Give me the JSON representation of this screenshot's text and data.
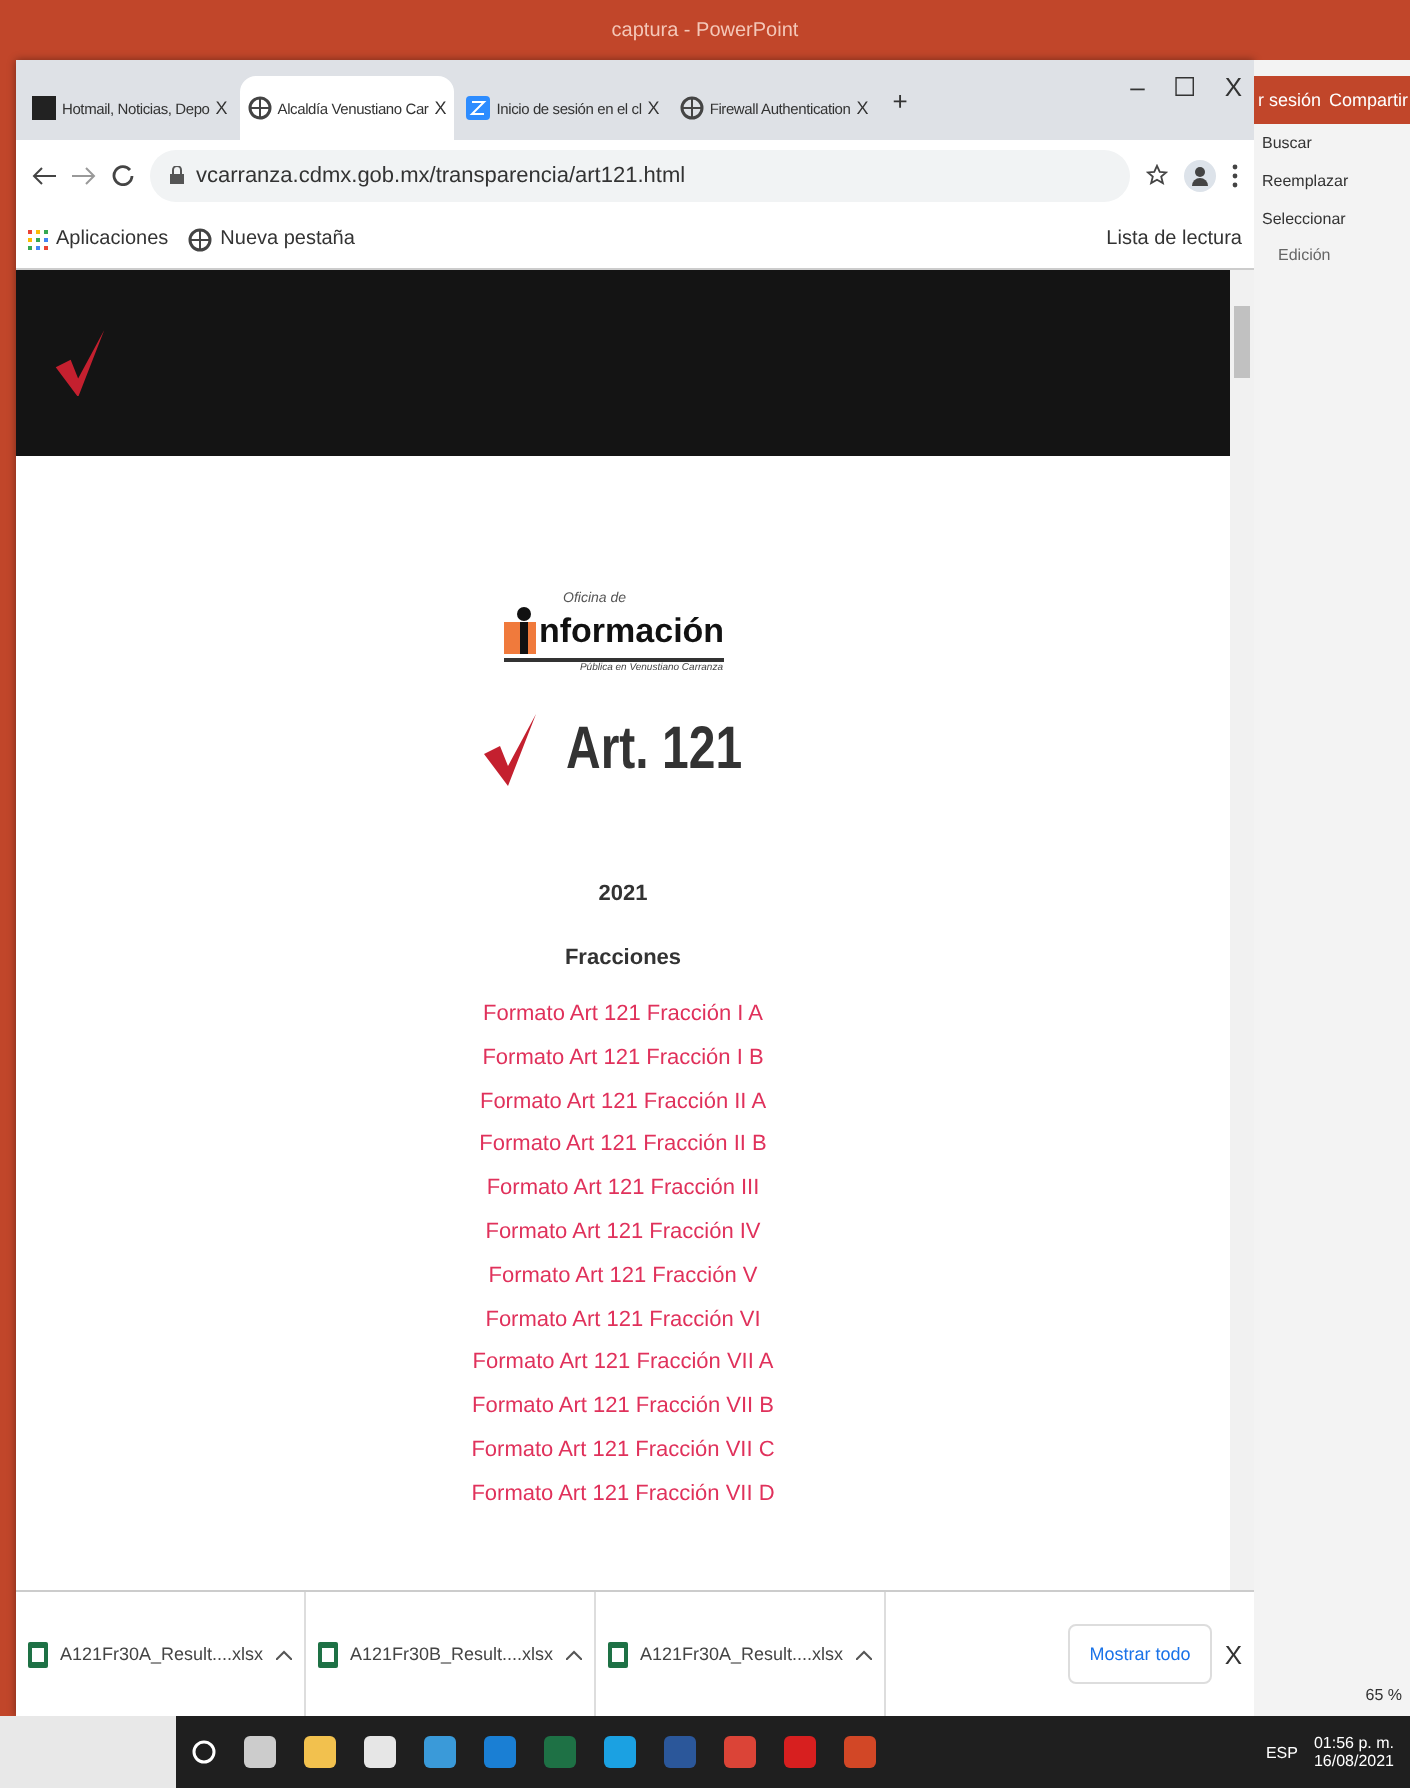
{
  "app_title": "captura - PowerPoint",
  "ribbon": {
    "account": [
      "r sesión",
      "Compartir"
    ],
    "items": [
      "Buscar",
      "Reemplazar",
      "Seleccionar"
    ],
    "group": "Edición",
    "zoom": "65 %"
  },
  "tabs": [
    {
      "label": "Hotmail, Noticias, Depo",
      "close": "X",
      "selected": false,
      "kind": "dark"
    },
    {
      "label": "Alcaldía Venustiano Car",
      "close": "X",
      "selected": true,
      "kind": "globe"
    },
    {
      "label": "Inicio de sesión en el cl",
      "close": "X",
      "selected": false,
      "kind": "z"
    },
    {
      "label": "Firewall Authentication",
      "close": "X",
      "selected": false,
      "kind": "globe"
    }
  ],
  "new_tab": "+",
  "window_controls": [
    "–",
    "☐",
    "X"
  ],
  "address": "vcarranza.cdmx.gob.mx/transparencia/art121.html",
  "bookmarks": [
    {
      "label": "Aplicaciones",
      "kind": "apps"
    },
    {
      "label": "Nueva pestaña",
      "kind": "globe"
    }
  ],
  "reading_list": "Lista de lectura",
  "page": {
    "logo_top": "Oficina de",
    "logo_main": "nformación",
    "logo_sub": "Pública en Venustiano Carranza",
    "heading": "Art. 121",
    "year": "2021",
    "section": "Fracciones",
    "links": [
      "Formato Art 121 Fracción I A",
      "Formato Art 121 Fracción I B",
      "Formato Art 121 Fracción II A",
      "Formato Art 121 Fracción II B",
      "Formato Art 121 Fracción III",
      "Formato Art 121 Fracción IV",
      "Formato Art 121 Fracción V",
      "Formato Art 121 Fracción VI",
      "Formato Art 121 Fracción VII A",
      "Formato Art 121 Fracción VII B",
      "Formato Art 121 Fracción VII C",
      "Formato Art 121 Fracción VII D"
    ]
  },
  "downloads": [
    "A121Fr30A_Result....xlsx",
    "A121Fr30B_Result....xlsx",
    "A121Fr30A_Result....xlsx"
  ],
  "show_all": "Mostrar todo",
  "downloads_close": "X",
  "taskbar": {
    "lang": "ESP",
    "time": "01:56 p. m.",
    "date": "16/08/2021"
  }
}
